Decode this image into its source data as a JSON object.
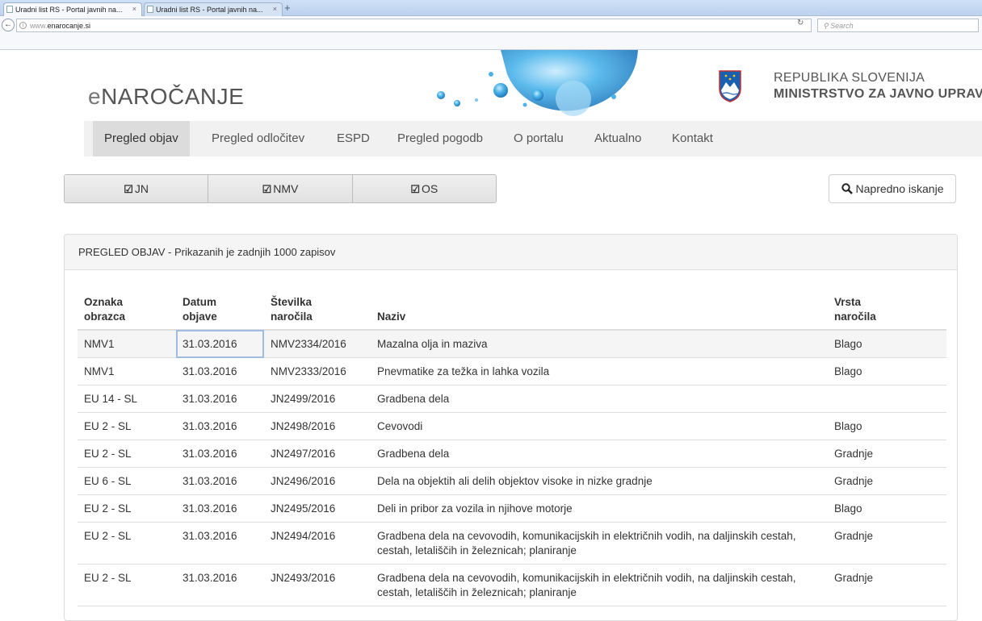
{
  "browser": {
    "tabs": [
      {
        "label": "Uradni list RS - Portal javnih na..."
      },
      {
        "label": "Uradni list RS - Portal javnih na..."
      }
    ],
    "new_tab": "+",
    "close_symbol": "×",
    "url_prefix": "www.",
    "url_domain": "enarocanje.si",
    "search_placeholder": "Search"
  },
  "header": {
    "logo_e": "e",
    "logo_rest": "NAROČANJE",
    "republic": "REPUBLIKA SLOVENIJA",
    "ministry": "MINISTRSTVO ZA JAVNO UPRAVO"
  },
  "nav": {
    "items": [
      {
        "label": "Pregled objav"
      },
      {
        "label": "Pregled odločitev"
      },
      {
        "label": "ESPD"
      },
      {
        "label": "Pregled pogodb"
      },
      {
        "label": "O portalu"
      },
      {
        "label": "Aktualno"
      },
      {
        "label": "Kontakt"
      }
    ]
  },
  "filters": {
    "items": [
      {
        "label": "JN"
      },
      {
        "label": "NMV"
      },
      {
        "label": "OS"
      }
    ],
    "advanced_search": "Napredno iskanje"
  },
  "panel": {
    "title": "PREGLED OBJAV - Prikazanih je zadnjih 1000 zapisov",
    "columns": {
      "c1a": "Oznaka",
      "c1b": "obrazca",
      "c2a": "Datum",
      "c2b": "objave",
      "c3a": "Številka",
      "c3b": "naročila",
      "c4": "Naziv",
      "c5a": "Vrsta",
      "c5b": "naročila"
    },
    "rows": [
      {
        "form": "NMV1",
        "date": "31.03.2016",
        "number": "NMV2334/2016",
        "title": "Mazalna olja in maziva",
        "type": "Blago"
      },
      {
        "form": "NMV1",
        "date": "31.03.2016",
        "number": "NMV2333/2016",
        "title": "Pnevmatike za težka in lahka vozila",
        "type": "Blago"
      },
      {
        "form": "EU 14 - SL",
        "date": "31.03.2016",
        "number": "JN2499/2016",
        "title": "Gradbena dela",
        "type": ""
      },
      {
        "form": "EU 2 - SL",
        "date": "31.03.2016",
        "number": "JN2498/2016",
        "title": "Cevovodi",
        "type": "Blago"
      },
      {
        "form": "EU 2 - SL",
        "date": "31.03.2016",
        "number": "JN2497/2016",
        "title": "Gradbena dela",
        "type": "Gradnje"
      },
      {
        "form": "EU 6 - SL",
        "date": "31.03.2016",
        "number": "JN2496/2016",
        "title": "Dela na objektih ali delih objektov visoke in nizke gradnje",
        "type": "Gradnje"
      },
      {
        "form": "EU 2 - SL",
        "date": "31.03.2016",
        "number": "JN2495/2016",
        "title": "Deli in pribor za vozila in njihove motorje",
        "type": "Blago"
      },
      {
        "form": "EU 2 - SL",
        "date": "31.03.2016",
        "number": "JN2494/2016",
        "title": "Gradbena dela na cevovodih, komunikacijskih in električnih vodih, na daljinskih cestah, cestah, letališčih in železnicah; planiranje",
        "type": "Gradnje"
      },
      {
        "form": "EU 2 - SL",
        "date": "31.03.2016",
        "number": "JN2493/2016",
        "title": "Gradbena dela na cevovodih, komunikacijskih in električnih vodih, na daljinskih cestah, cestah, letališčih in železnicah; planiranje",
        "type": "Gradnje"
      }
    ]
  }
}
